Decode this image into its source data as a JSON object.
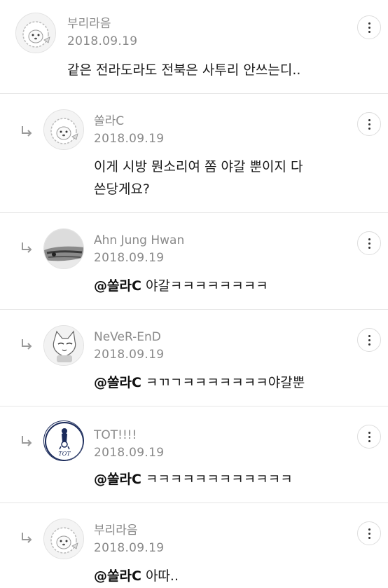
{
  "comments": [
    {
      "author": "부리라음",
      "date": "2018.09.19",
      "text": "같은 전라도라도 전북은 사투리 안쓰는디..",
      "avatar_icon": "hedgehog-avatar-icon",
      "is_reply": false
    },
    {
      "author": "쏠라C",
      "date": "2018.09.19",
      "text": "이게 시방 뭔소리여 쫌 야갈 뿐이지 다\n쓴당게요?",
      "avatar_icon": "hedgehog-avatar-icon",
      "is_reply": true
    },
    {
      "author": "Ahn Jung Hwan",
      "date": "2018.09.19",
      "mention": "@쏠라C",
      "text": " 야갈ㅋㅋㅋㅋㅋㅋㅋㅋ",
      "avatar_icon": "car-photo-avatar-icon",
      "is_reply": true
    },
    {
      "author": "NeVeR-EnD",
      "date": "2018.09.19",
      "mention": "@쏠라C",
      "text": " ㅋㄲㄱㅋㅋㅋㅋㅋㅋㅋ야갈뿐",
      "avatar_icon": "cat-avatar-icon",
      "is_reply": true
    },
    {
      "author": "TOT!!!!",
      "date": "2018.09.19",
      "mention": "@쏠라C",
      "text": " ㅋㅋㅋㅋㅋㅋㅋㅋㅋㅋㅋㅋ",
      "avatar_icon": "tottenham-crest-avatar-icon",
      "avatar_label": "TOT",
      "is_reply": true
    },
    {
      "author": "부리라음",
      "date": "2018.09.19",
      "mention": "@쏠라C",
      "text": " 아따..",
      "avatar_icon": "hedgehog-avatar-icon",
      "is_reply": true
    }
  ]
}
